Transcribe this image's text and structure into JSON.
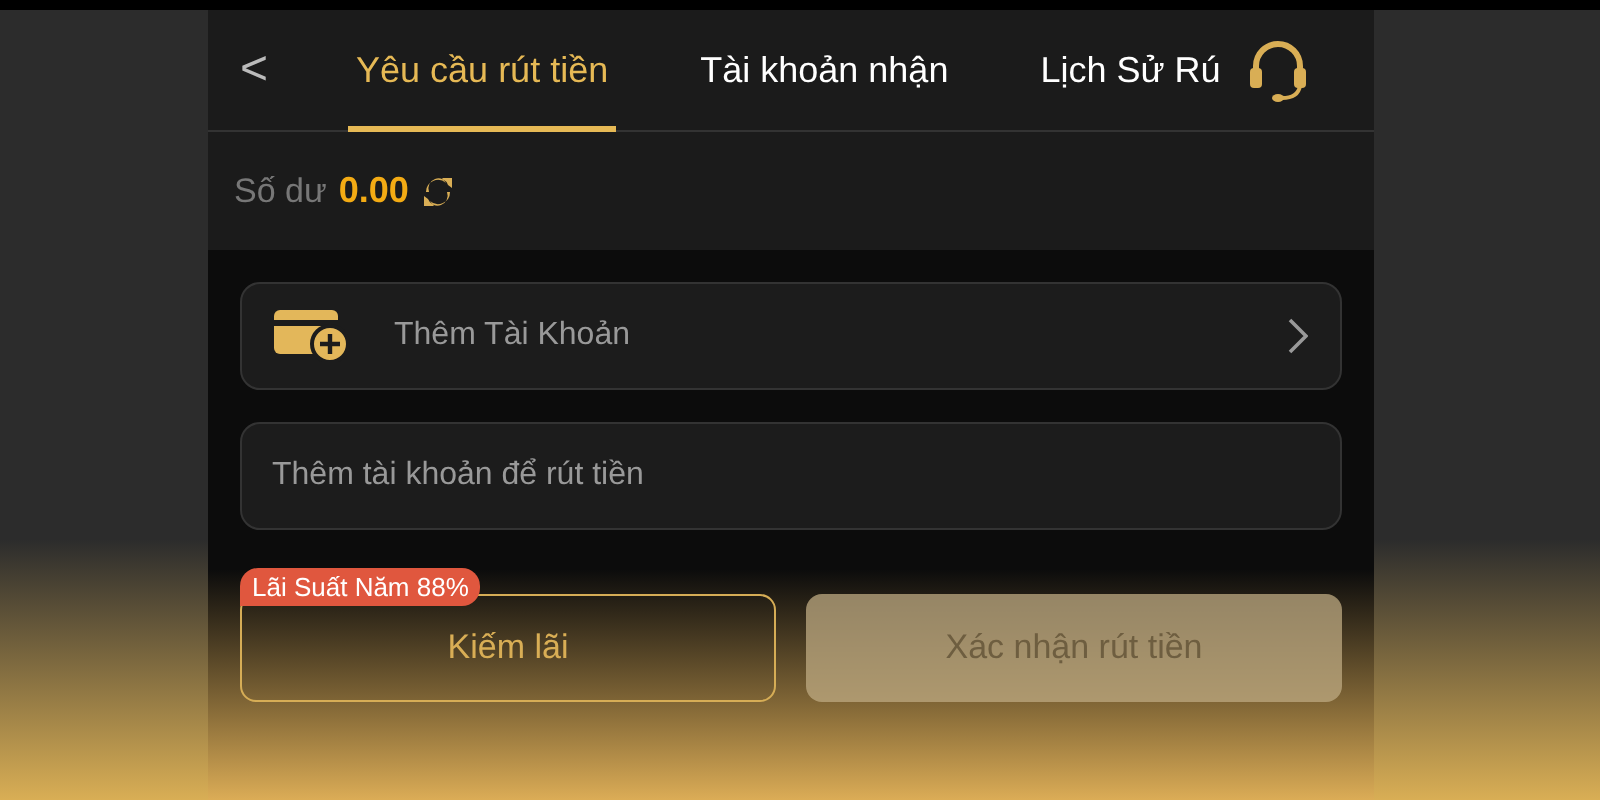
{
  "header": {
    "back": "<",
    "tabs": [
      {
        "label": "Yêu cầu rút tiền",
        "selected": true
      },
      {
        "label": "Tài khoản nhận",
        "selected": false
      },
      {
        "label": "Lịch Sử Rú",
        "selected": false
      }
    ]
  },
  "balance": {
    "label": "Số dư",
    "amount": "0.00"
  },
  "account_row": {
    "label": "Thêm Tài Khoản"
  },
  "account_field": {
    "placeholder": "Thêm tài khoản để rút tiền"
  },
  "earn_button": {
    "label": "Kiếm lãi",
    "badge": "Lãi Suất Năm 88%"
  },
  "confirm_button": {
    "label": "Xác nhận rút tiền",
    "disabled": true
  }
}
